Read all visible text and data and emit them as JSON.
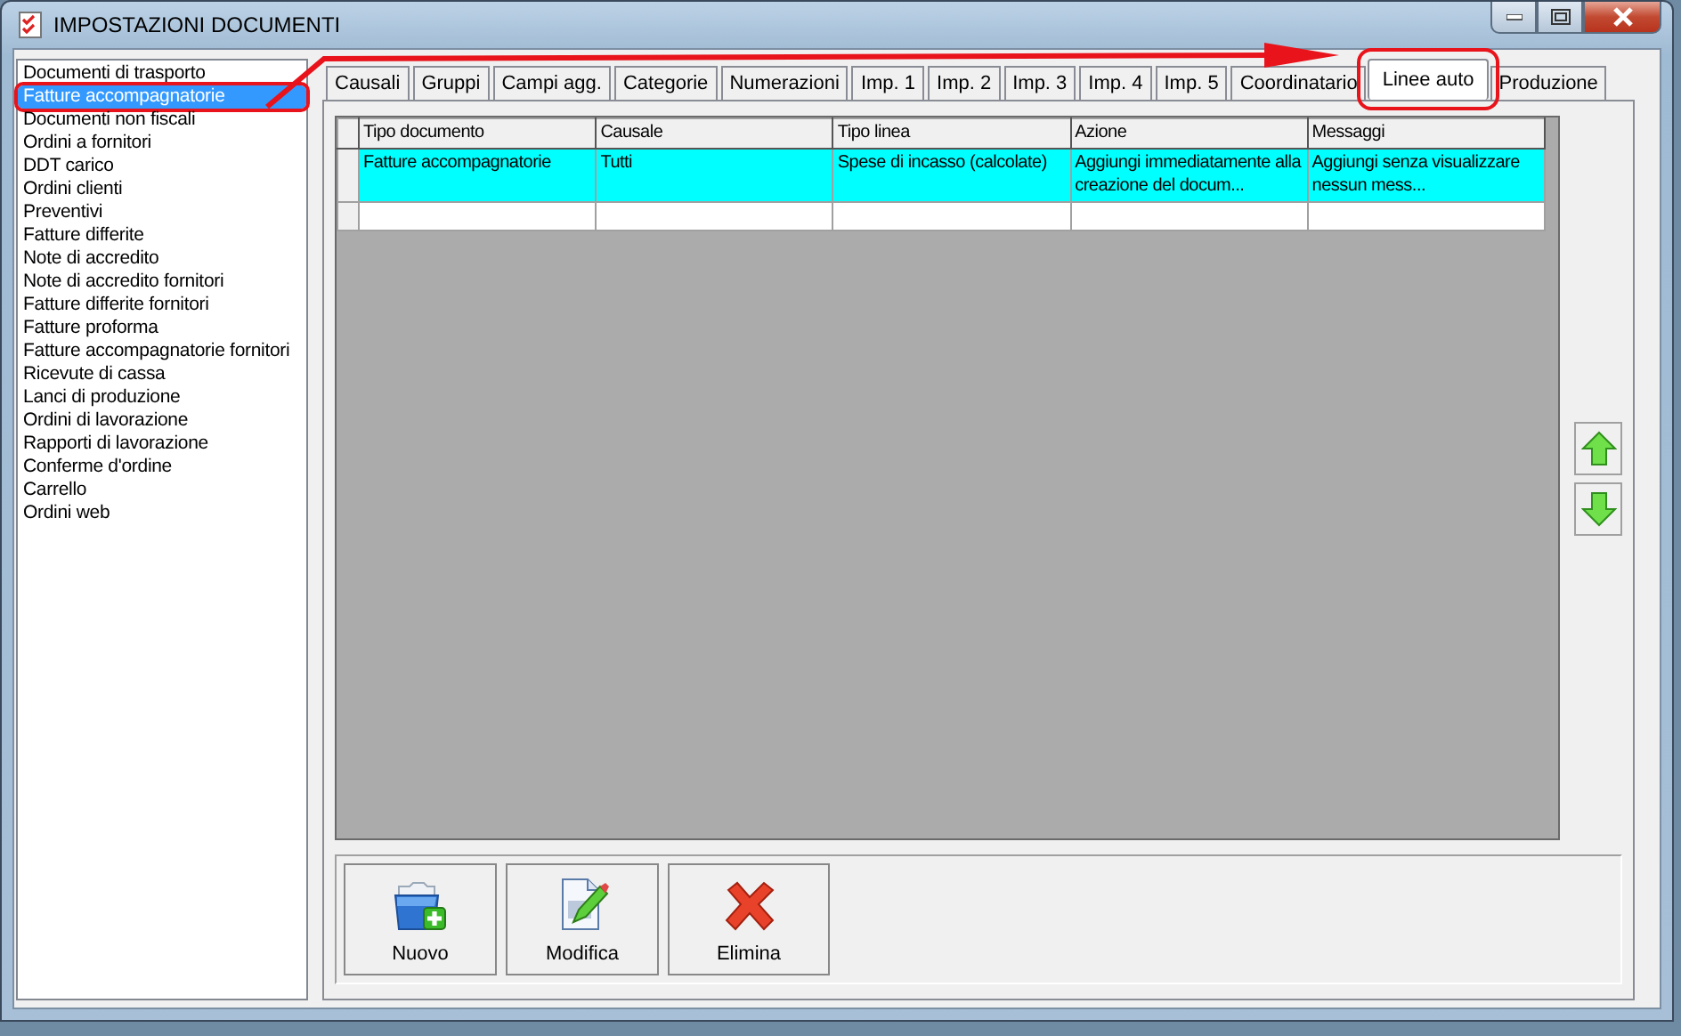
{
  "window": {
    "title": "IMPOSTAZIONI DOCUMENTI"
  },
  "document_types": [
    {
      "label": "Documenti di trasporto",
      "selected": false,
      "highlighted": false
    },
    {
      "label": "Fatture accompagnatorie",
      "selected": true,
      "highlighted": true
    },
    {
      "label": "Documenti non fiscali",
      "selected": false,
      "highlighted": false
    },
    {
      "label": "Ordini a fornitori",
      "selected": false,
      "highlighted": false
    },
    {
      "label": "DDT carico",
      "selected": false,
      "highlighted": false
    },
    {
      "label": "Ordini clienti",
      "selected": false,
      "highlighted": false
    },
    {
      "label": "Preventivi",
      "selected": false,
      "highlighted": false
    },
    {
      "label": "Fatture differite",
      "selected": false,
      "highlighted": false
    },
    {
      "label": "Note di accredito",
      "selected": false,
      "highlighted": false
    },
    {
      "label": "Note di accredito fornitori",
      "selected": false,
      "highlighted": false
    },
    {
      "label": "Fatture differite fornitori",
      "selected": false,
      "highlighted": false
    },
    {
      "label": "Fatture proforma",
      "selected": false,
      "highlighted": false
    },
    {
      "label": "Fatture accompagnatorie fornitori",
      "selected": false,
      "highlighted": false
    },
    {
      "label": "Ricevute di cassa",
      "selected": false,
      "highlighted": false
    },
    {
      "label": "Lanci di produzione",
      "selected": false,
      "highlighted": false
    },
    {
      "label": "Ordini di lavorazione",
      "selected": false,
      "highlighted": false
    },
    {
      "label": "Rapporti di lavorazione",
      "selected": false,
      "highlighted": false
    },
    {
      "label": "Conferme d'ordine",
      "selected": false,
      "highlighted": false
    },
    {
      "label": "Carrello",
      "selected": false,
      "highlighted": false
    },
    {
      "label": "Ordini web",
      "selected": false,
      "highlighted": false
    }
  ],
  "tabs": [
    {
      "label": "Causali",
      "selected": false,
      "highlighted": false
    },
    {
      "label": "Gruppi",
      "selected": false,
      "highlighted": false
    },
    {
      "label": "Campi agg.",
      "selected": false,
      "highlighted": false
    },
    {
      "label": "Categorie",
      "selected": false,
      "highlighted": false
    },
    {
      "label": "Numerazioni",
      "selected": false,
      "highlighted": false
    },
    {
      "label": "Imp. 1",
      "selected": false,
      "highlighted": false
    },
    {
      "label": "Imp. 2",
      "selected": false,
      "highlighted": false
    },
    {
      "label": "Imp. 3",
      "selected": false,
      "highlighted": false
    },
    {
      "label": "Imp. 4",
      "selected": false,
      "highlighted": false
    },
    {
      "label": "Imp. 5",
      "selected": false,
      "highlighted": false
    },
    {
      "label": "Coordinatario",
      "selected": false,
      "highlighted": false
    },
    {
      "label": "Linee auto",
      "selected": true,
      "highlighted": true
    },
    {
      "label": "Produzione",
      "selected": false,
      "highlighted": false
    }
  ],
  "annotation_arrow": true,
  "table": {
    "columns": [
      "Tipo documento",
      "Causale",
      "Tipo linea",
      "Azione",
      "Messaggi"
    ],
    "rows": [
      {
        "cells": [
          "Fatture accompagnatorie",
          "Tutti",
          "Spese di incasso (calcolate)",
          "Aggiungi immediatamente alla creazione del docum...",
          "Aggiungi senza visualizzare nessun mess..."
        ],
        "selected": true
      }
    ]
  },
  "buttons": [
    {
      "kind": "new",
      "label": "Nuovo"
    },
    {
      "kind": "edit",
      "label": "Modifica"
    },
    {
      "kind": "delete",
      "label": "Elimina"
    }
  ]
}
